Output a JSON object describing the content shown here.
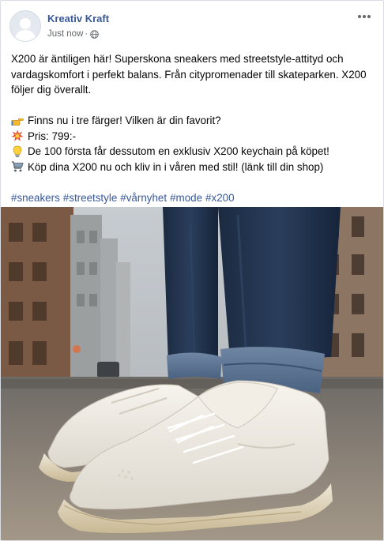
{
  "post": {
    "author": "Kreativ Kraft",
    "timestamp": "Just now",
    "separator": "·",
    "privacy_icon": "globe-icon",
    "more_icon": "more-options-icon",
    "intro": "X200 är äntiligen här! Superskona sneakers med streetstyle-attityd och vardagskomfort i perfekt balans. Från citypromenader till skateparken. X200 följer dig överallt.",
    "bullets": [
      {
        "icon": "pointing-hand-icon",
        "text": "Finns nu i tre färger! Vilken är din favorit?"
      },
      {
        "icon": "collision-icon",
        "text": "Pris: 799:-"
      },
      {
        "icon": "light-bulb-icon",
        "text": "De 100 första får dessutom en exklusiv X200 keychain på köpet!"
      },
      {
        "icon": "shopping-cart-icon",
        "text": "Köp dina X200 nu och kliv in i våren med stil! (länk till din shop)"
      }
    ],
    "hashtags": [
      "#sneakers",
      "#streetstyle",
      "#vårnyhet",
      "#mode",
      "#x200"
    ]
  },
  "colors": {
    "link": "#385898",
    "meta": "#65676b",
    "text": "#050505"
  }
}
